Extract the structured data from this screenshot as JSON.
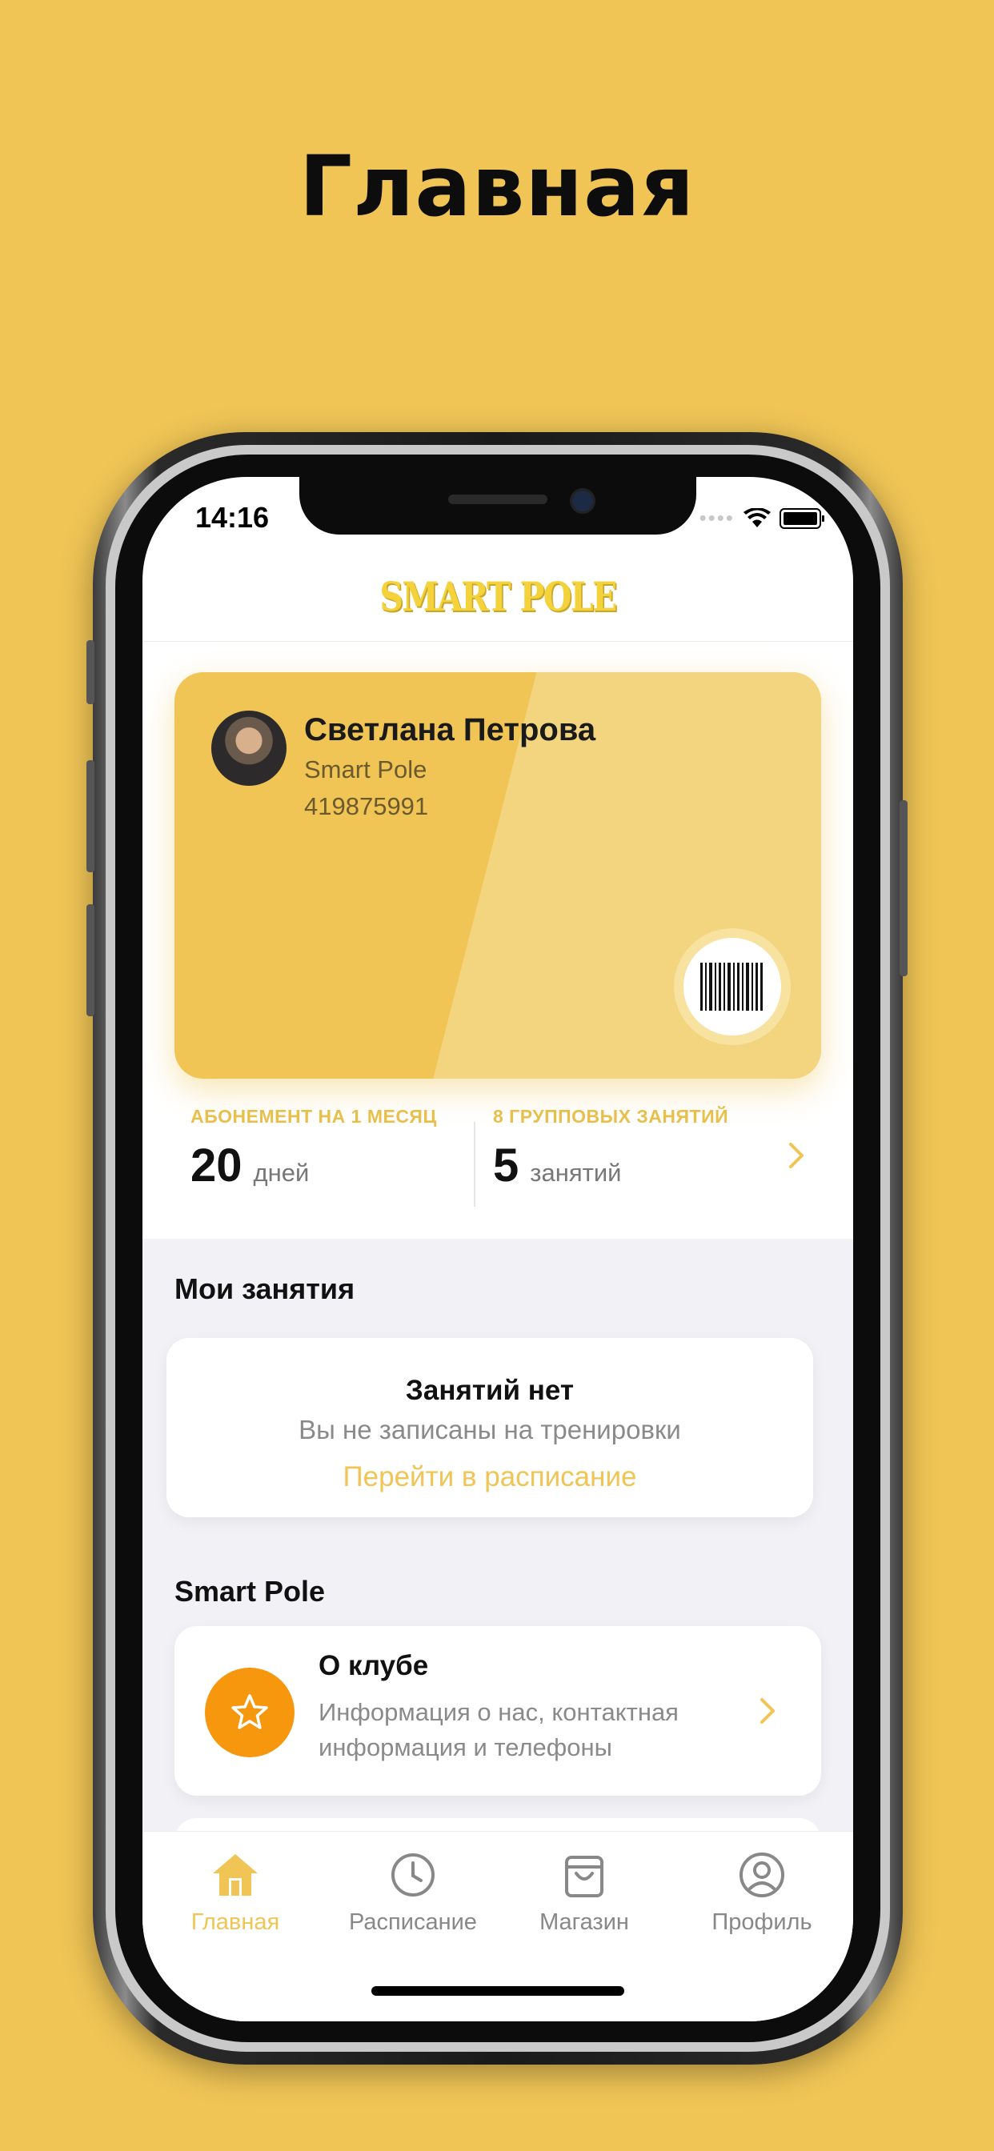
{
  "promo": {
    "title": "Главная"
  },
  "status_bar": {
    "time": "14:16"
  },
  "header": {
    "logo_text": "SMART POLE"
  },
  "member_card": {
    "name": "Светлана Петрова",
    "club": "Smart Pole",
    "number": "419875991"
  },
  "subscriptions": [
    {
      "label": "АБОНЕМЕНТ НА 1 МЕСЯЦ",
      "value": "20",
      "unit": "дней"
    },
    {
      "label": "8 ГРУППОВЫХ ЗАНЯТИЙ",
      "value": "5",
      "unit": "занятий"
    }
  ],
  "my_classes": {
    "section_title": "Мои занятия",
    "empty_title": "Занятий нет",
    "empty_subtitle": "Вы не записаны на тренировки",
    "link": "Перейти в расписание"
  },
  "club_section": {
    "section_title": "Smart Pole",
    "items": [
      {
        "title": "О клубе",
        "description": "Информация о нас, контактная информация и телефоны"
      }
    ]
  },
  "tabbar": {
    "items": [
      {
        "label": "Главная",
        "icon": "home-icon",
        "active": true
      },
      {
        "label": "Расписание",
        "icon": "clock-icon",
        "active": false
      },
      {
        "label": "Магазин",
        "icon": "shopping-bag-icon",
        "active": false
      },
      {
        "label": "Профиль",
        "icon": "user-circle-icon",
        "active": false
      }
    ]
  },
  "colors": {
    "background": "#F0C556",
    "accent": "#F0C556",
    "club_icon": "#F7970E"
  }
}
